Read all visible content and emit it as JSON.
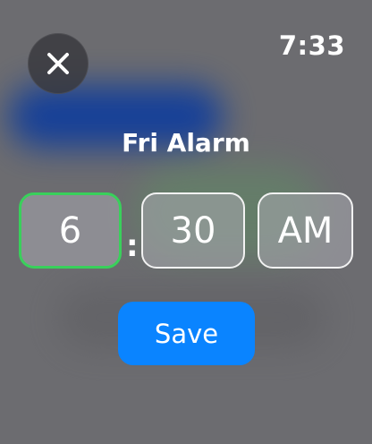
{
  "status": {
    "time": "7:33"
  },
  "close_button": {
    "icon": "close-icon"
  },
  "title": "Fri Alarm",
  "time_picker": {
    "hour": "6",
    "separator": ":",
    "minute": "30",
    "period": "AM",
    "selected_field": "hour"
  },
  "save_label": "Save",
  "colors": {
    "background": "#6c6c70",
    "accent_blue": "#0a84ff",
    "selected_green": "#39d05b",
    "text": "#ffffff"
  }
}
